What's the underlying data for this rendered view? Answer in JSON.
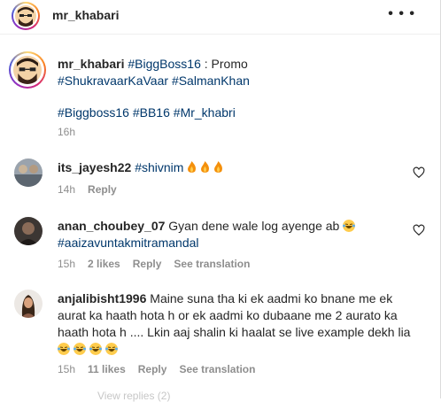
{
  "post": {
    "author": "mr_khabari",
    "more_icon": "more-horizontal-icon"
  },
  "caption": {
    "author": "mr_khabari",
    "tag1": "#BiggBoss16",
    "text1": " : Promo",
    "tag2": "#ShukravaarKaVaar",
    "tag3": "#SalmanKhan",
    "tag4": "#Biggboss16",
    "tag5": "#BB16",
    "tag6": "#Mr_khabri",
    "time": "16h"
  },
  "comments": [
    {
      "user": "its_jayesh22",
      "tag": "#shivnim",
      "time": "14h",
      "reply": "Reply"
    },
    {
      "user": "anan_choubey_07",
      "text": "Gyan dene wale log ayenge ab",
      "tag": "#aaizavuntakmitramandal",
      "time": "15h",
      "likes": "2 likes",
      "reply": "Reply",
      "translate": "See translation"
    },
    {
      "user": "anjalibisht1996",
      "line1": "Maine suna tha ki ek aadmi ko bnane me ek",
      "line2": "aurat ka haath hota h or ek aadmi ko dubaane me 2 aurato ka",
      "line3": "haath hota h .... Lkin aaj shalin ki haalat se live example dekh lia",
      "time": "15h",
      "likes": "11 likes",
      "reply": "Reply",
      "translate": "See translation"
    }
  ],
  "view_replies": "View replies (2)",
  "colors": {
    "hashtag": "#00376b",
    "meta": "#8e8e8e",
    "text": "#262626"
  }
}
